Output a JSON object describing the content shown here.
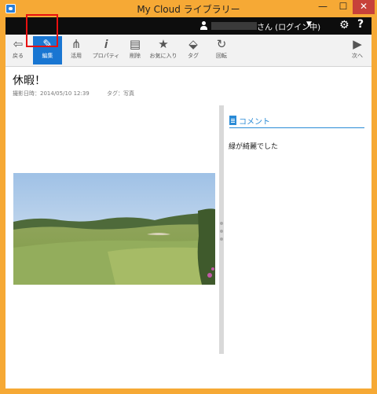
{
  "window": {
    "title": "My Cloud ライブラリー",
    "controls": {
      "minimize": "—",
      "maximize": "☐",
      "close": "✕"
    }
  },
  "topbar": {
    "user_suffix": "さん (ログイン中)",
    "caret": "▼",
    "settings_glyph": "⚙",
    "help_glyph": "?"
  },
  "toolbar": {
    "items": [
      {
        "label": "戻る",
        "icon": "back-arrow-icon",
        "glyph": "⇦"
      },
      {
        "label": "編集",
        "icon": "pencil-icon",
        "glyph": "✎"
      },
      {
        "label": "活用",
        "icon": "share-icon",
        "glyph": "⋔"
      },
      {
        "label": "プロパティ",
        "icon": "info-icon",
        "glyph": "𝒊"
      },
      {
        "label": "削除",
        "icon": "trash-icon",
        "glyph": "▤"
      },
      {
        "label": "お気に入り",
        "icon": "star-icon",
        "glyph": "★"
      },
      {
        "label": "タグ",
        "icon": "tag-icon",
        "glyph": "⬙"
      },
      {
        "label": "回転",
        "icon": "rotate-icon",
        "glyph": "↻"
      },
      {
        "label": "次へ",
        "icon": "next-arrow-icon",
        "glyph": "▶"
      }
    ],
    "active_index": 1,
    "active_color": "#1976d2"
  },
  "content": {
    "title": "休暇！",
    "date": "撮影日時：2014/05/10 12:39",
    "tag": "タグ：写真"
  },
  "comment": {
    "title": "コメント",
    "text": "緑が綺麗でした"
  },
  "colors": {
    "window_border": "#f6a935",
    "accent": "#2a8bd6",
    "highlight_box": "#e81010"
  }
}
